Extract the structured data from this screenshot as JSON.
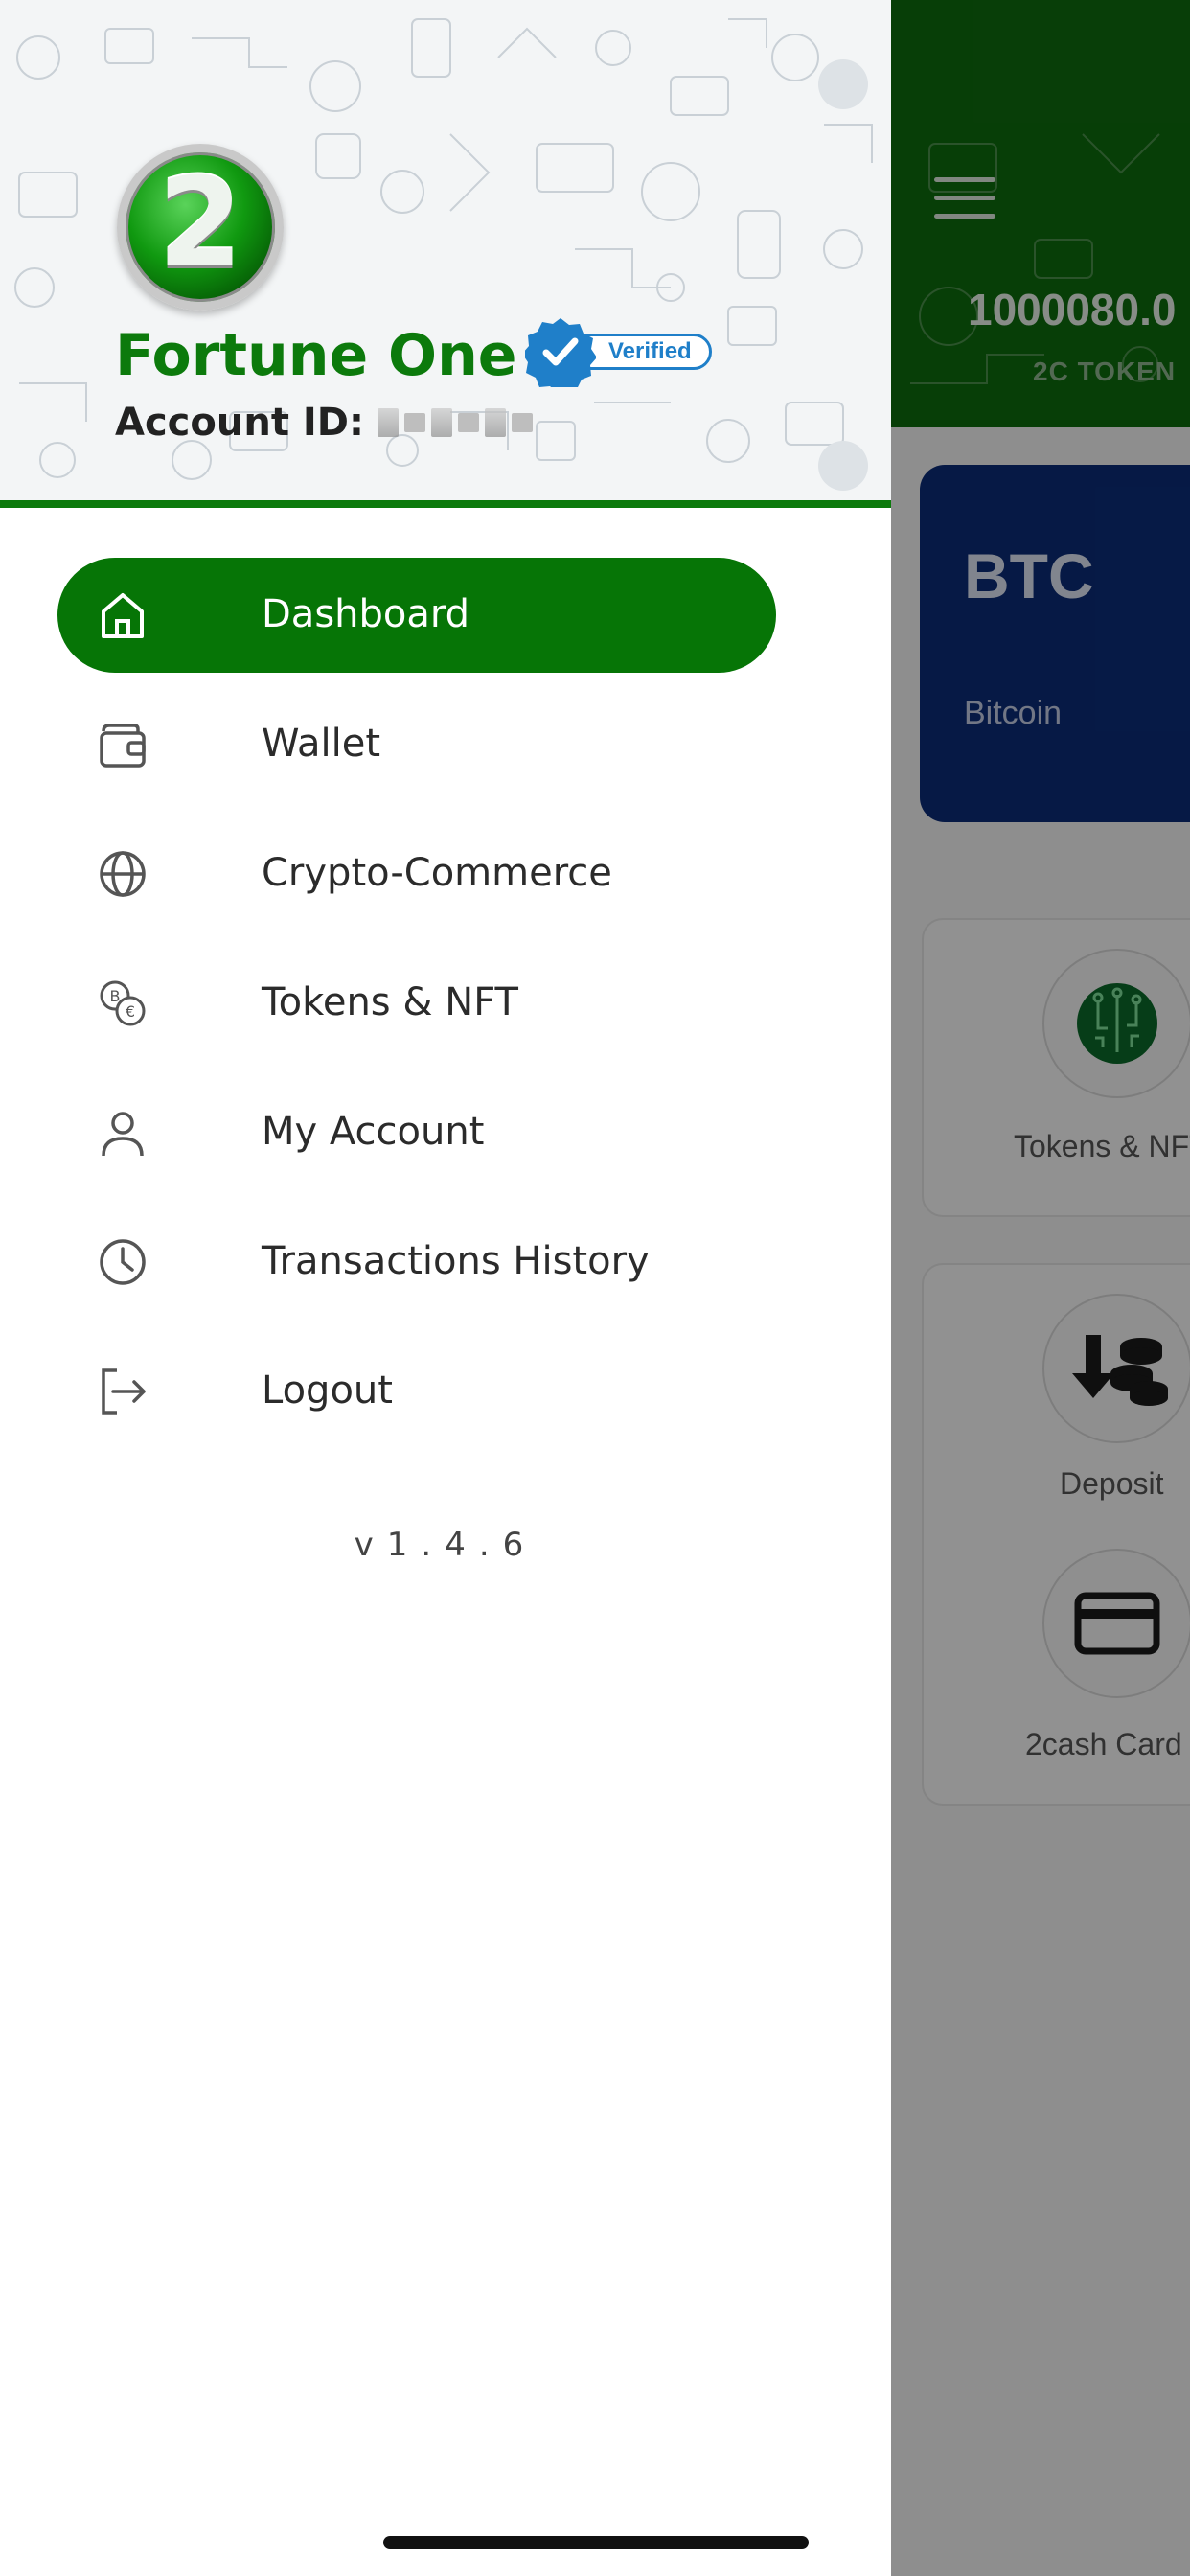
{
  "status_bar": {
    "icons": [
      "cellular-signal-icon",
      "wifi-icon",
      "battery-icon"
    ],
    "battery_level": 0.2
  },
  "background_screen": {
    "balance": "1000080.0",
    "token_label": "2C TOKEN",
    "btc_card": {
      "symbol": "BTC",
      "name": "Bitcoin"
    },
    "quick_actions": [
      {
        "label": "Tokens & NFT",
        "icon": "circuit-chip-icon"
      },
      {
        "label": "Deposit",
        "icon": "coins-deposit-icon"
      },
      {
        "label": "2cash Card",
        "icon": "credit-card-icon"
      }
    ]
  },
  "drawer": {
    "logo_text": "2",
    "user_name": "Fortune One",
    "verified_label": "Verified",
    "account_label": "Account ID:",
    "menu": [
      {
        "label": "Dashboard",
        "icon": "home-icon",
        "active": true
      },
      {
        "label": "Wallet",
        "icon": "wallet-icon",
        "active": false
      },
      {
        "label": "Crypto-Commerce",
        "icon": "globe-icon",
        "active": false
      },
      {
        "label": "Tokens & NFT",
        "icon": "coins-icon",
        "active": false
      },
      {
        "label": "My Account",
        "icon": "user-icon",
        "active": false
      },
      {
        "label": "Transactions History",
        "icon": "clock-icon",
        "active": false
      },
      {
        "label": "Logout",
        "icon": "logout-icon",
        "active": false
      }
    ],
    "version": "v1.4.6"
  },
  "colors": {
    "brand_green": "#067506",
    "name_green": "#0c7a0c",
    "verified_blue": "#1f7fc9",
    "btc_card_blue": "#0b2c78",
    "overlay": "rgba(0,0,0,0.42)"
  }
}
